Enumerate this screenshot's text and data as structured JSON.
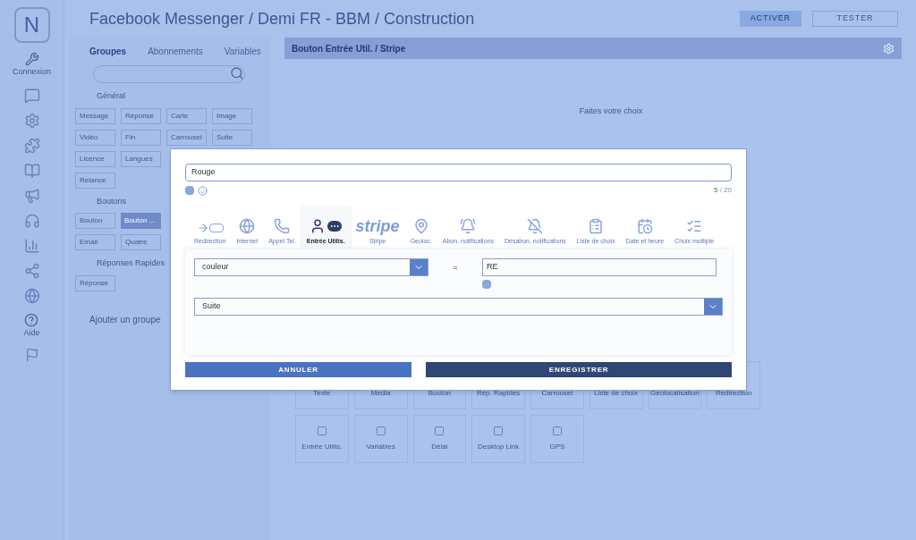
{
  "logo": "N",
  "header": {
    "title": "Facebook Messenger / Demi FR - BBM / Construction",
    "actions": [
      {
        "label": "ACTIVER",
        "kind": "filled"
      },
      {
        "label": "TESTER",
        "kind": "outline"
      }
    ]
  },
  "sidebar": {
    "items": [
      {
        "label": "Connexion"
      },
      {
        "label": "Aide"
      }
    ]
  },
  "groups_panel": {
    "tabs": [
      {
        "label": "Groupes",
        "selected": true
      },
      {
        "label": "Abonnements",
        "selected": false
      },
      {
        "label": "Variables",
        "selected": false
      }
    ],
    "sections": [
      {
        "title": "Général",
        "rows": [
          [
            {
              "label": "Message",
              "selected": false
            },
            {
              "label": "Réponse",
              "selected": false
            },
            {
              "label": "Carte",
              "selected": false
            },
            {
              "label": "Image",
              "selected": false
            }
          ],
          [
            {
              "label": "Vidéo",
              "selected": false
            },
            {
              "label": "Fin",
              "selected": false
            },
            {
              "label": "Carrousel",
              "selected": false
            },
            {
              "label": "Suite",
              "selected": false
            }
          ],
          [
            {
              "label": "Licence",
              "selected": false
            },
            {
              "label": "Langues",
              "selected": false
            }
          ],
          [
            {
              "label": "Relance",
              "selected": false
            }
          ]
        ]
      },
      {
        "title": "Boutons",
        "rows": [
          [
            {
              "label": "Bouton",
              "selected": false
            },
            {
              "label": "Bouton ...",
              "selected": true
            }
          ],
          [
            {
              "label": "Email",
              "selected": false
            },
            {
              "label": "Quatre",
              "selected": false
            }
          ]
        ]
      },
      {
        "title": "Réponses Rapides",
        "rows": [
          [
            {
              "label": "Réponse",
              "selected": false
            }
          ]
        ]
      }
    ],
    "add_link": "Ajouter un groupe"
  },
  "main_panel": {
    "title": "Bouton Entrée Util. / Stripe",
    "placeholder_text": "Faites votre choix",
    "components": [
      {
        "label": "Texte"
      },
      {
        "label": "Média"
      },
      {
        "label": "Bouton"
      },
      {
        "label": "Rép. Rapides"
      },
      {
        "label": "Carrousel"
      },
      {
        "label": "Liste de choix"
      },
      {
        "label": "Géolocalisation"
      },
      {
        "label": "Redirection"
      },
      {
        "label": "Entrée Utilis."
      },
      {
        "label": "Variables"
      },
      {
        "label": "Délai"
      },
      {
        "label": "Desktop Link"
      },
      {
        "label": "GPS"
      }
    ]
  },
  "modal": {
    "name_field": {
      "value": "Rouge"
    },
    "counter": {
      "current": "5",
      "max": "/ 20"
    },
    "tabs": [
      {
        "label": "Redirection",
        "kind": "redirect",
        "selected": false
      },
      {
        "label": "Internet",
        "kind": "globe",
        "selected": false
      },
      {
        "label": "Appel Tel.",
        "kind": "phone",
        "selected": false
      },
      {
        "label": "Entrée Utilis.",
        "kind": "input",
        "selected": true
      },
      {
        "label": "Stripe",
        "kind": "stripe",
        "logo_text": "stripe",
        "selected": false
      },
      {
        "label": "Geoloc.",
        "kind": "pin",
        "selected": false
      },
      {
        "label": "Abon. notifications",
        "kind": "bell",
        "selected": false
      },
      {
        "label": "Désabon. notifications",
        "kind": "mute",
        "selected": false
      },
      {
        "label": "Liste de choix",
        "kind": "list",
        "selected": false
      },
      {
        "label": "Date et heure",
        "kind": "calendar",
        "selected": false
      },
      {
        "label": "Choix multiple",
        "kind": "checklist",
        "selected": false
      }
    ],
    "condition": {
      "variable": "couleur",
      "operator": "=",
      "value": "RE"
    },
    "next_select": "Suite",
    "buttons": [
      {
        "label": "ANNULER",
        "kind": "secondary"
      },
      {
        "label": "ENREGISTRER",
        "kind": "primary"
      }
    ]
  }
}
